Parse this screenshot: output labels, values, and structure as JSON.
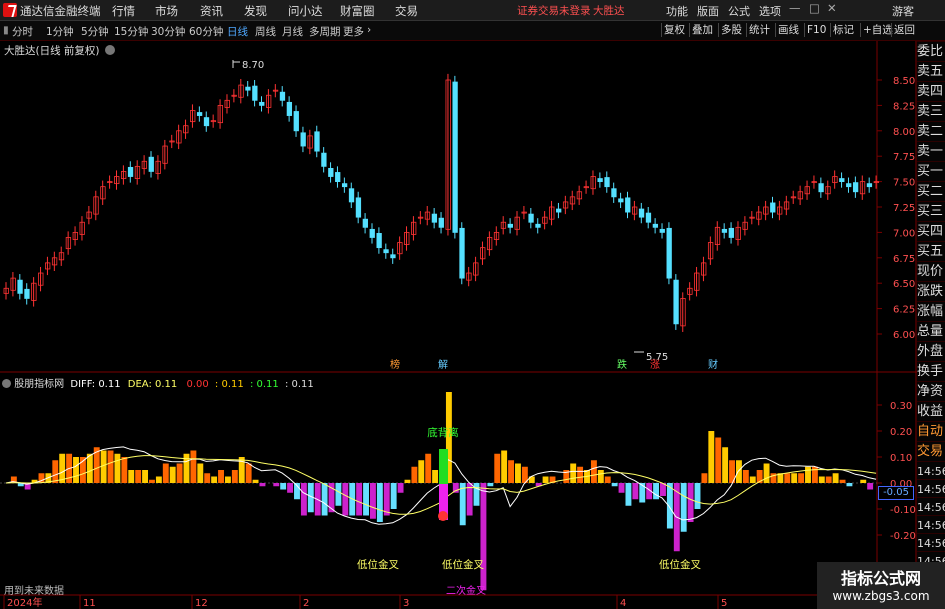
{
  "titlebar": {
    "app_name": "通达信金融终端",
    "menu": [
      "行情",
      "市场",
      "资讯",
      "发现",
      "问小达",
      "财富圈",
      "交易"
    ],
    "status_text": "证券交易未登录",
    "stock_name": "大胜达",
    "right_menu": [
      "功能",
      "版面",
      "公式",
      "选项"
    ],
    "guest": "游客"
  },
  "tabbar": {
    "periods": [
      "分时",
      "1分钟",
      "5分钟",
      "15分钟",
      "30分钟",
      "60分钟",
      "日线",
      "周线",
      "月线",
      "多周期",
      "更多"
    ],
    "active": "日线",
    "tools": [
      "复权",
      "叠加",
      "多股",
      "统计",
      "画线",
      "F10",
      "标记",
      "+自选",
      "返回"
    ]
  },
  "main_chart": {
    "title": "大胜达(日线 前复权)",
    "high_label": "8.70",
    "low_label": "5.75",
    "y_ticks": [
      "8.50",
      "8.25",
      "8.00",
      "7.75",
      "7.50",
      "7.25",
      "7.00",
      "6.75",
      "6.50",
      "6.25",
      "6.00"
    ],
    "event_markers": [
      "榜",
      "解",
      "跌",
      "涨",
      "财"
    ]
  },
  "indicator": {
    "name": "股朋指标网",
    "diff_label": "DIFF:",
    "diff_value": "0.11",
    "dea_label": "DEA:",
    "dea_value": "0.11",
    "v1": "0.00",
    "v2": ": 0.11",
    "v3": ": 0.11",
    "v4": ": 0.11",
    "y_ticks": [
      "0.30",
      "0.20",
      "0.10",
      "0.00",
      "-0.10",
      "-0.20"
    ],
    "current_value": "-0.05",
    "annotations": {
      "bottom_divergence": "底背离",
      "golden_cross_1": "低位金叉",
      "golden_cross_2": "低位金叉",
      "golden_cross_3": "低位金叉",
      "second_cross": "二次金叉"
    },
    "footer_note": "用到未来数据"
  },
  "time_axis": [
    "2024年",
    "11",
    "12",
    "2",
    "3",
    "4",
    "5"
  ],
  "sidebar": {
    "items": [
      "委比",
      "卖五",
      "卖四",
      "卖三",
      "卖二",
      "卖一",
      "买一",
      "买二",
      "买三",
      "买四",
      "买五",
      "现价",
      "涨跌",
      "涨幅",
      "总量",
      "外盘",
      "换手",
      "净资",
      "收益",
      "自动",
      "交易"
    ],
    "time_labels": [
      "14:56",
      "14:56",
      "14:56",
      "14:56",
      "14:56",
      "14:56",
      "14:56",
      "14:56"
    ]
  },
  "watermark": {
    "title": "指标公式网",
    "url": "www.zbgs3.com"
  },
  "colors": {
    "up": "#ff3333",
    "down": "#55e0ff",
    "axis_red": "#ff5050",
    "diff_line": "#ffffff",
    "dea_line": "#ffff66"
  }
}
